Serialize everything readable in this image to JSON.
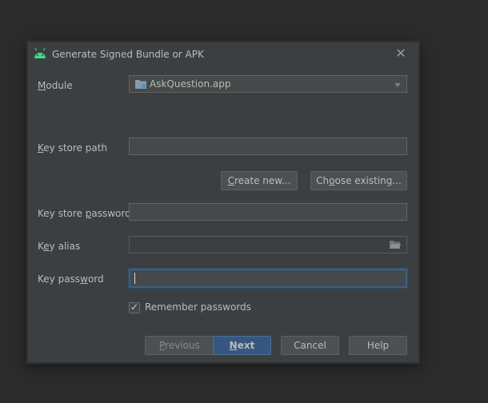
{
  "dialog": {
    "title": "Generate Signed Bundle or APK",
    "icon": "android-icon",
    "close_icon": "close-icon"
  },
  "module": {
    "label": "Module",
    "value": "AskQuestion.app",
    "icon": "folder-module-icon"
  },
  "key_store_path": {
    "label": "Key store path",
    "value": ""
  },
  "buttons": {
    "create_new": "Create new...",
    "choose_existing": "Choose existing...",
    "previous": "Previous",
    "next": "Next",
    "cancel": "Cancel",
    "help": "Help"
  },
  "key_store_password": {
    "label": "Key store password",
    "value": ""
  },
  "key_alias": {
    "label": "Key alias",
    "value": "",
    "icon": "folder-browse-icon"
  },
  "key_password": {
    "label": "Key password",
    "value": ""
  },
  "remember_passwords": {
    "label": "Remember passwords",
    "checked": true
  },
  "colors": {
    "background": "#2b2b2b",
    "dialog": "#3c3f41",
    "primary_button": "#365880",
    "focus_border": "#3d6185",
    "android_green": "#3ddc84"
  }
}
